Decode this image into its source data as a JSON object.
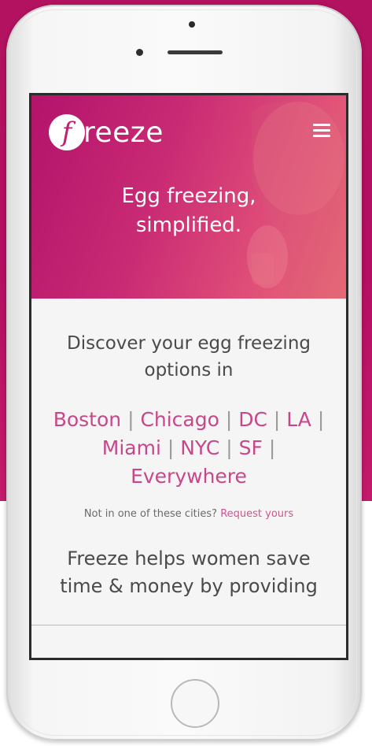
{
  "header": {
    "logo_letter": "f",
    "logo_text": "reeze",
    "menu_icon": "hamburger-icon"
  },
  "hero": {
    "title": "Egg freezing,\nsimplified."
  },
  "discover": {
    "text": "Discover your egg freezing options in"
  },
  "cities": [
    "Boston",
    "Chicago",
    "DC",
    "LA",
    "Miami",
    "NYC",
    "SF",
    "Everywhere"
  ],
  "request": {
    "prefix": "Not in one of these cities?",
    "link": "Request yours"
  },
  "pitch": {
    "text": "Freeze helps women save time & money by providing"
  },
  "colors": {
    "brand": "#b50f62",
    "link": "#c7488a",
    "hero_gradient_start": "#b3136a",
    "hero_gradient_end": "#ea6d73"
  }
}
